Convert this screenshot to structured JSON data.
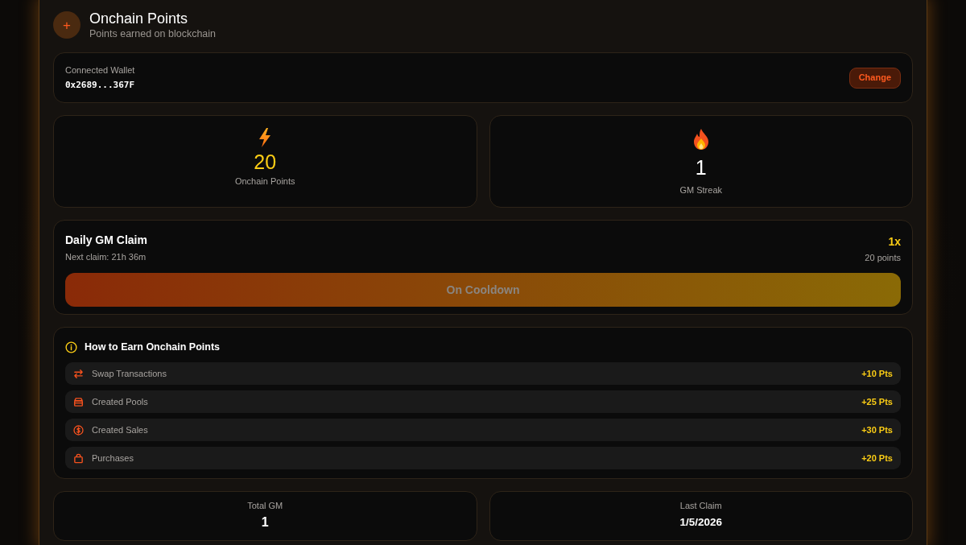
{
  "header": {
    "icon_text": "+",
    "title": "Onchain Points",
    "subtitle": "Points earned on blockchain"
  },
  "wallet": {
    "label": "Connected Wallet",
    "address": "0x2689...367F",
    "button": "Change"
  },
  "stats": [
    {
      "value": "20",
      "label": "Onchain Points",
      "color": "#facc15"
    },
    {
      "value": "1",
      "label": "GM Streak",
      "color": "#ffffff"
    }
  ],
  "daily_claim": {
    "title": "Daily GM Claim",
    "next_claim": "Next claim: 21h 36m",
    "multiplier": "1x",
    "points": "20 points",
    "button": {
      "label": "On Cooldown",
      "disabled": true
    }
  },
  "how_to_earn": {
    "title": "How to Earn Onchain Points",
    "items": [
      {
        "label": "Swap Transactions",
        "points": "+10 Pts"
      },
      {
        "label": "Created Pools",
        "points": "+25 Pts"
      },
      {
        "label": "Created Sales",
        "points": "+30 Pts"
      },
      {
        "label": "Purchases",
        "points": "+20 Pts"
      }
    ]
  },
  "summary": [
    {
      "label": "Total GM",
      "value": "1"
    },
    {
      "label": "Last Claim",
      "value": "1/5/2026"
    }
  ]
}
